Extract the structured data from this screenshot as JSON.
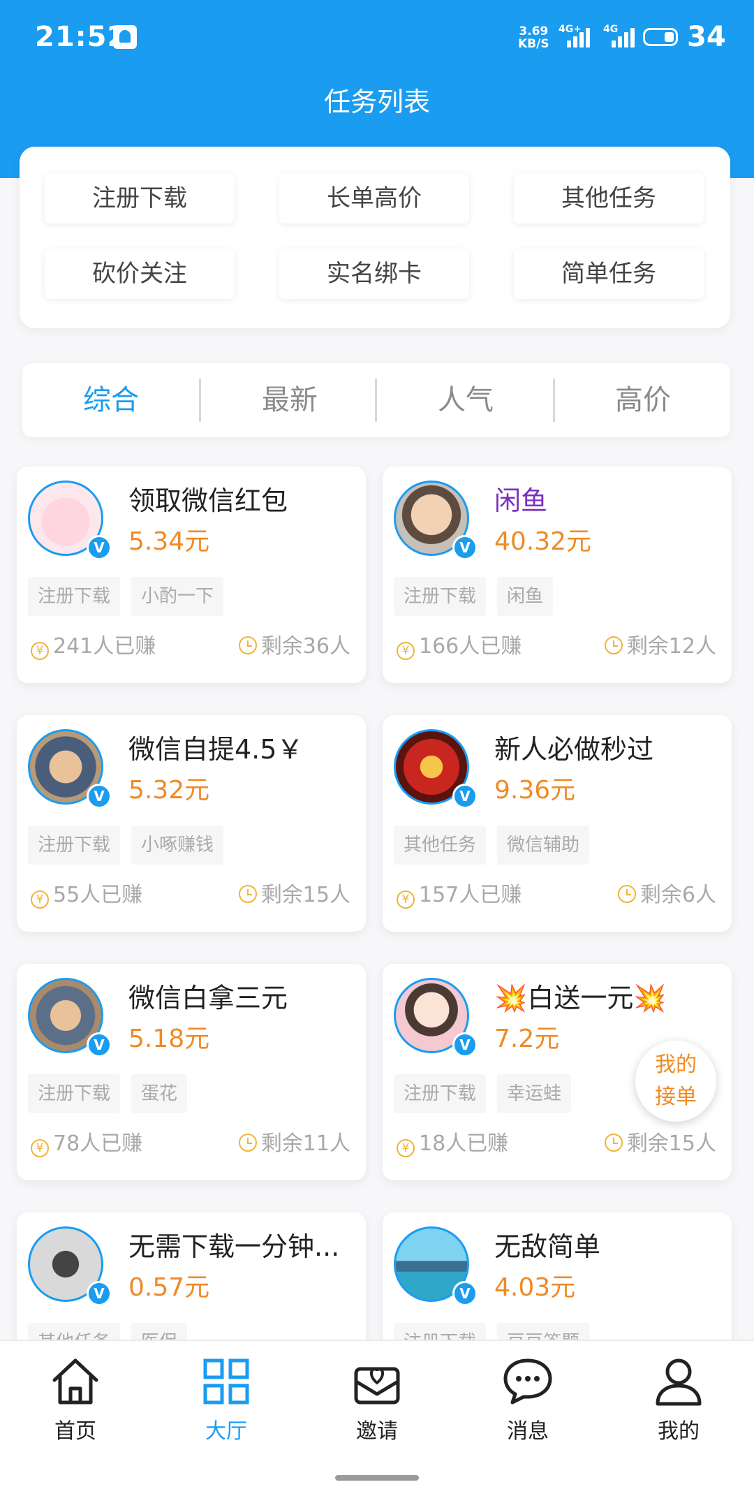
{
  "status_bar": {
    "time": "21:52",
    "net_speed_value": "3.69",
    "net_speed_unit": "KB/S",
    "signal1_tag": "4G+",
    "signal2_tag": "4G",
    "battery_level": "34"
  },
  "header": {
    "title": "任务列表"
  },
  "categories": [
    "注册下载",
    "长单高价",
    "其他任务",
    "砍价关注",
    "实名绑卡",
    "简单任务"
  ],
  "sort_tabs": [
    "综合",
    "最新",
    "人气",
    "高价"
  ],
  "sort_active": "综合",
  "tasks": [
    {
      "title": "领取微信红包",
      "price": "5.34元",
      "tags": [
        "注册下载",
        "小酌一下"
      ],
      "earned": "241人已赚",
      "remaining": "剩余36人",
      "verified": "V"
    },
    {
      "title": "闲鱼",
      "price": "40.32元",
      "tags": [
        "注册下载",
        "闲鱼"
      ],
      "earned": "166人已赚",
      "remaining": "剩余12人",
      "verified": "V"
    },
    {
      "title": "微信自提4.5￥",
      "price": "5.32元",
      "tags": [
        "注册下载",
        "小啄赚钱"
      ],
      "earned": "55人已赚",
      "remaining": "剩余15人",
      "verified": "V"
    },
    {
      "title": "新人必做秒过",
      "price": "9.36元",
      "tags": [
        "其他任务",
        "微信辅助"
      ],
      "earned": "157人已赚",
      "remaining": "剩余6人",
      "verified": "V"
    },
    {
      "title": "微信白拿三元",
      "price": "5.18元",
      "tags": [
        "注册下载",
        "蛋花"
      ],
      "earned": "78人已赚",
      "remaining": "剩余11人",
      "verified": "V"
    },
    {
      "title": "💥白送一元💥",
      "price": "7.2元",
      "tags": [
        "注册下载",
        "幸运蛙"
      ],
      "earned": "18人已赚",
      "remaining": "剩余15人",
      "verified": "V"
    },
    {
      "title": "无需下载一分钟...",
      "price": "0.57元",
      "tags": [
        "其他任务",
        "医保"
      ],
      "earned": "",
      "remaining": "",
      "verified": "V"
    },
    {
      "title": "无敌简单",
      "price": "4.03元",
      "tags": [
        "注册下载",
        "豆豆答题"
      ],
      "earned": "",
      "remaining": "",
      "verified": "V"
    }
  ],
  "floating_button": {
    "line1": "我的",
    "line2": "接单"
  },
  "bottom_nav": [
    "首页",
    "大厅",
    "邀请",
    "消息",
    "我的"
  ],
  "bottom_nav_active": "大厅",
  "colors": {
    "primary": "#1a9cf0",
    "price": "#f08a24",
    "icon_accent": "#f0b437"
  },
  "yen_glyph": "¥"
}
